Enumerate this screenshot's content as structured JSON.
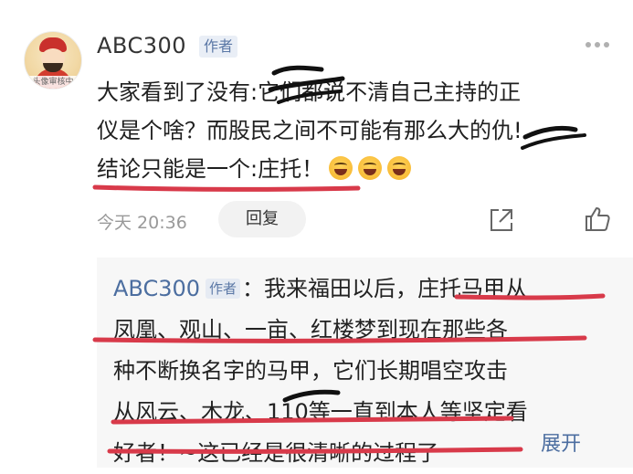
{
  "comment": {
    "username": "ABC300",
    "author_badge": "作者",
    "avatar_tag": "头像审核中",
    "lines": [
      "大家看到了没有:它们都说不清自己主持的正",
      "仪是个啥？而股民之间不可能有那么大的仇!",
      "结论只能是一个:庄托！"
    ],
    "emoji_icons": [
      "laughing-emoji-icon",
      "laughing-emoji-icon",
      "laughing-emoji-icon"
    ],
    "time": "今天 20:36",
    "reply_label": "回复"
  },
  "reply": {
    "username": "ABC300",
    "author_badge": "作者",
    "separator": "：",
    "lines": [
      "我来福田以后，庄托马甲从",
      "凤凰、观山、一亩、红楼梦到现在那些各",
      "种不断换名字的马甲，它们长期唱空攻击",
      "从风云、木龙、110等一直到本人等坚定看",
      "好者！~这已经是很清晰的过程了"
    ],
    "expand_label": "展开"
  },
  "icons": {
    "more": "more-dots-icon",
    "share": "share-icon",
    "like": "thumbs-up-icon"
  },
  "colors": {
    "accent_blue": "#4c6ea0",
    "marker_red": "#d83a4a",
    "scribble_black": "#111111"
  }
}
